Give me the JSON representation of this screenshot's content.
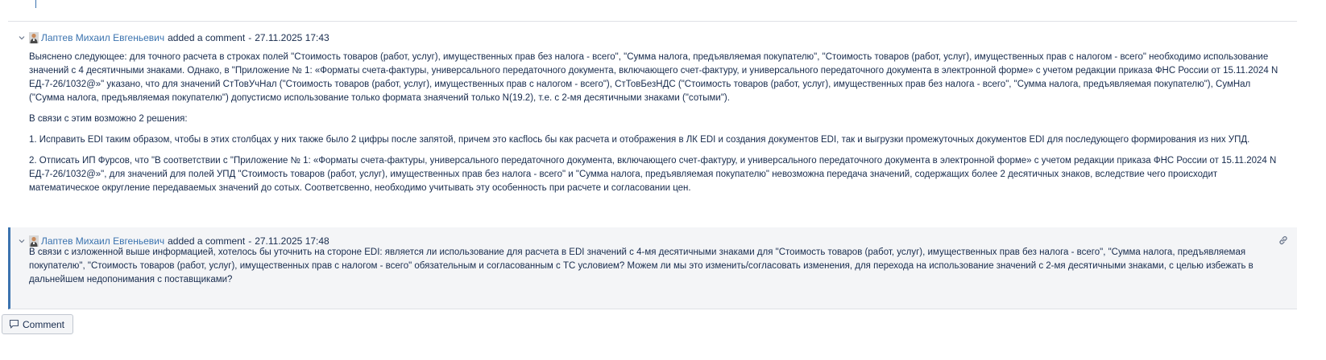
{
  "comments": [
    {
      "author": "Лаптев Михаил Евгеньевич",
      "action": "added a comment",
      "separator": "-",
      "date": "27.11.2025 17:43",
      "paragraphs": [
        "Выяснено следующее: для точного расчета в строках полей \"Стоимость товаров (работ, услуг), имущественных прав без налога - всего\", \"Сумма налога, предъявляемая покупателю\", \"Стоимость товаров (работ, услуг), имущественных прав с налогом - всего\" необходимо использование значений с 4 десятичными знаками. Однако, в \"Приложение № 1: «Форматы счета-фактуры, универсального передаточного документа, включающего счет-фактуру, и универсального передаточного документа в электронной форме» с учетом редакции приказа ФНС России от 15.11.2024 N ЕД-7-26/1032@»\" указано, что для значений СтТовУчНал (\"Стоимость товаров (работ, услуг), имущественных прав с налогом - всего\"), СтТовБезНДС (\"Стоимость товаров (работ, услуг), имущественных прав без налога - всего\", \"Сумма налога, предъявляемая покупателю\"), СумНал (\"Сумма налога, предъявляемая покупателю\") допустисмо использование только формата знаячений только N(19.2), т.е. с 2-мя десятичными знаками (\"сотыми\").",
        "В связи с этим возможно 2 решения:",
        "1. Исправить EDI таким образом, чтобы в этих столбцах у них также было 2 цифры после запятой, причем это касflось бы как расчета и отображения в ЛК EDI и создания документов EDI, так и выгрузки промежуточных документов EDI для последующего формирования из них УПД.",
        "2. Отписать ИП Фурсов, что \"В соответствии с \"Приложение № 1: «Форматы счета-фактуры, универсального передаточного документа, включающего счет-фактуру, и универсального передаточного документа в электронной форме» с учетом редакции приказа ФНС России от 15.11.2024 N ЕД-7-26/1032@»\", для значений для полей УПД \"Стоимость товаров (работ, услуг), имущественных прав без налога - всего\" и \"Сумма налога, предъявляемая покупателю\" невозможна передача значений, содержащих более 2 десятичных знаков, вследствие чего происходит математическое округление передаваемых значений до сотых. Соответсвенно, необходимо учитывать эту особенность при расчете и согласовании цен."
      ]
    },
    {
      "author": "Лаптев Михаил Евгеньевич",
      "action": "added a comment",
      "separator": "-",
      "date": "27.11.2025 17:48",
      "paragraphs": [
        "В связи с изложенной выше информацией, хотелось бы уточнить на стороне EDI: является ли использование для расчета в EDI значений с 4-мя десятичными знаками для  \"Стоимость товаров (работ, услуг), имущественных прав без налога - всего\", \"Сумма налога, предъявляемая покупателю\", \"Стоимость товаров (работ, услуг), имущественных прав с налогом - всего\" обязательным и согласованным с ТС условием? Можем ли мы это изменить/согласовать изменения, для перехода на использование значений с 2-мя десятичными знаками, с целью избежать в дальнейшем недопонимания  с поставщиками?"
      ]
    }
  ],
  "comment_button": {
    "label": "Comment",
    "icon": "comment-icon"
  },
  "icons": {
    "toggle": "chevron-down-icon",
    "avatar": "user-avatar-icon",
    "permalink": "link-icon"
  },
  "colors": {
    "link": "#3b73af",
    "text": "#172b4d",
    "highlight_bg": "#f4f5f7",
    "highlight_border": "#3b73af"
  }
}
